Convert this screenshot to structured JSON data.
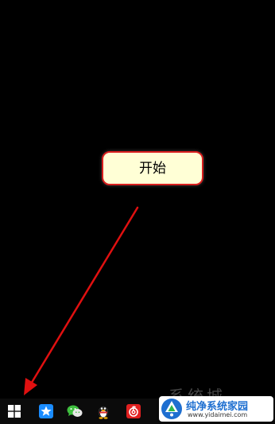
{
  "annotation": {
    "callout_text": "开始",
    "callout_fill": "#ffffd6",
    "callout_border": "#d81e1e",
    "arrow_color": "#e01010"
  },
  "taskbar": {
    "background": "#0b0b0b",
    "items": [
      {
        "icon": "windows-start-icon"
      },
      {
        "icon": "star-app-icon"
      },
      {
        "icon": "wechat-icon"
      },
      {
        "icon": "qq-penguin-icon"
      },
      {
        "icon": "netease-music-icon"
      }
    ]
  },
  "watermark": {
    "ghost_text": "系统城",
    "title": "纯净系统家园",
    "url": "www.yidaimei.com",
    "accent": "#1e6fd0"
  }
}
